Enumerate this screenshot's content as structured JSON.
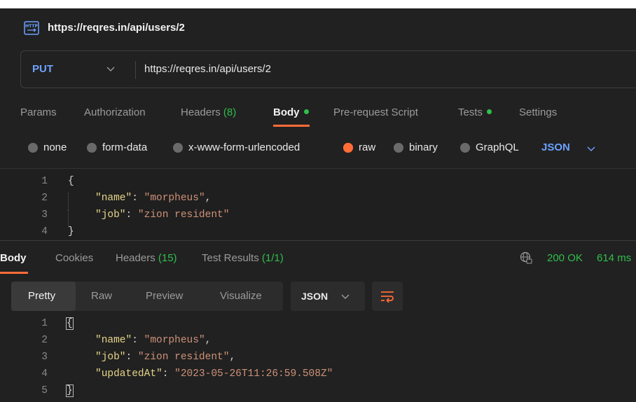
{
  "title_bar": {
    "title": "https://reqres.in/api/users/2",
    "icon": "http-icon"
  },
  "request": {
    "method": "PUT",
    "url": "https://reqres.in/api/users/2",
    "tabs": [
      {
        "label": "Params"
      },
      {
        "label": "Authorization"
      },
      {
        "label": "Headers",
        "count": "(8)"
      },
      {
        "label": "Body",
        "active": true,
        "dot": true
      },
      {
        "label": "Pre-request Script"
      },
      {
        "label": "Tests",
        "dot": true
      },
      {
        "label": "Settings"
      }
    ],
    "body_types": [
      "none",
      "form-data",
      "x-www-form-urlencoded",
      "raw",
      "binary",
      "GraphQL"
    ],
    "selected_body_type": "raw",
    "format": "JSON",
    "editor_lines": [
      {
        "n": "1",
        "text": "{"
      },
      {
        "n": "2",
        "key": "\"name\"",
        "value": "\"morpheus\"",
        "trail": ","
      },
      {
        "n": "3",
        "key": "\"job\"",
        "value": "\"zion resident\"",
        "trail": ""
      },
      {
        "n": "4",
        "text": "}"
      }
    ]
  },
  "response": {
    "tabs": [
      {
        "label": "Body",
        "active": true
      },
      {
        "label": "Cookies"
      },
      {
        "label": "Headers",
        "count": "(15)"
      },
      {
        "label": "Test Results",
        "count": "(1/1)"
      }
    ],
    "status": "200 OK",
    "time": "614 ms",
    "view_modes": [
      "Pretty",
      "Raw",
      "Preview",
      "Visualize"
    ],
    "format": "JSON",
    "lines": [
      {
        "n": "1",
        "text": "{"
      },
      {
        "n": "2",
        "key": "\"name\"",
        "value": "\"morpheus\"",
        "trail": ","
      },
      {
        "n": "3",
        "key": "\"job\"",
        "value": "\"zion resident\"",
        "trail": ","
      },
      {
        "n": "4",
        "key": "\"updatedAt\"",
        "value": "\"2023-05-26T11:26:59.508Z\"",
        "trail": ""
      },
      {
        "n": "5",
        "text": "}"
      }
    ]
  },
  "colors": {
    "accent": "#ff6c37",
    "method": "#6ca2ff",
    "success": "#2fbf4d"
  }
}
